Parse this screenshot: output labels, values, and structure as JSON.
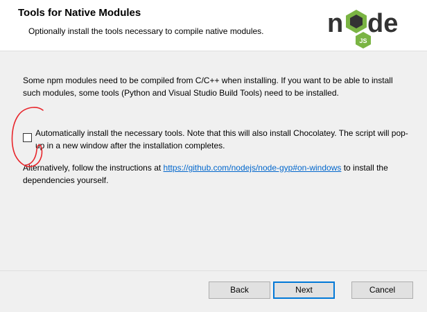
{
  "header": {
    "title": "Tools for Native Modules",
    "subtitle": "Optionally install the tools necessary to compile native modules.",
    "logo": {
      "word_left": "n",
      "word_right": "de",
      "badge": "JS"
    }
  },
  "main": {
    "intro": "Some npm modules need to be compiled from C/C++ when installing. If you want to be able to install such modules, some tools (Python and Visual Studio Build Tools) need to be installed.",
    "auto_install_checkbox": {
      "checked": false,
      "label": "Automatically install the necessary tools. Note that this will also install Chocolatey. The script will pop-up in a new window after the installation completes."
    },
    "alternative": {
      "prefix": "Alternatively, follow the instructions at ",
      "link_text": "https://github.com/nodejs/node-gyp#on-windows",
      "suffix": " to install the dependencies yourself."
    }
  },
  "footer": {
    "back_label": "Back",
    "next_label": "Next",
    "cancel_label": "Cancel"
  },
  "colors": {
    "link": "#0066cc",
    "annotation": "#e8262c",
    "default_button_border": "#0078d7",
    "node_dark": "#333333",
    "node_green": "#7ab443"
  }
}
